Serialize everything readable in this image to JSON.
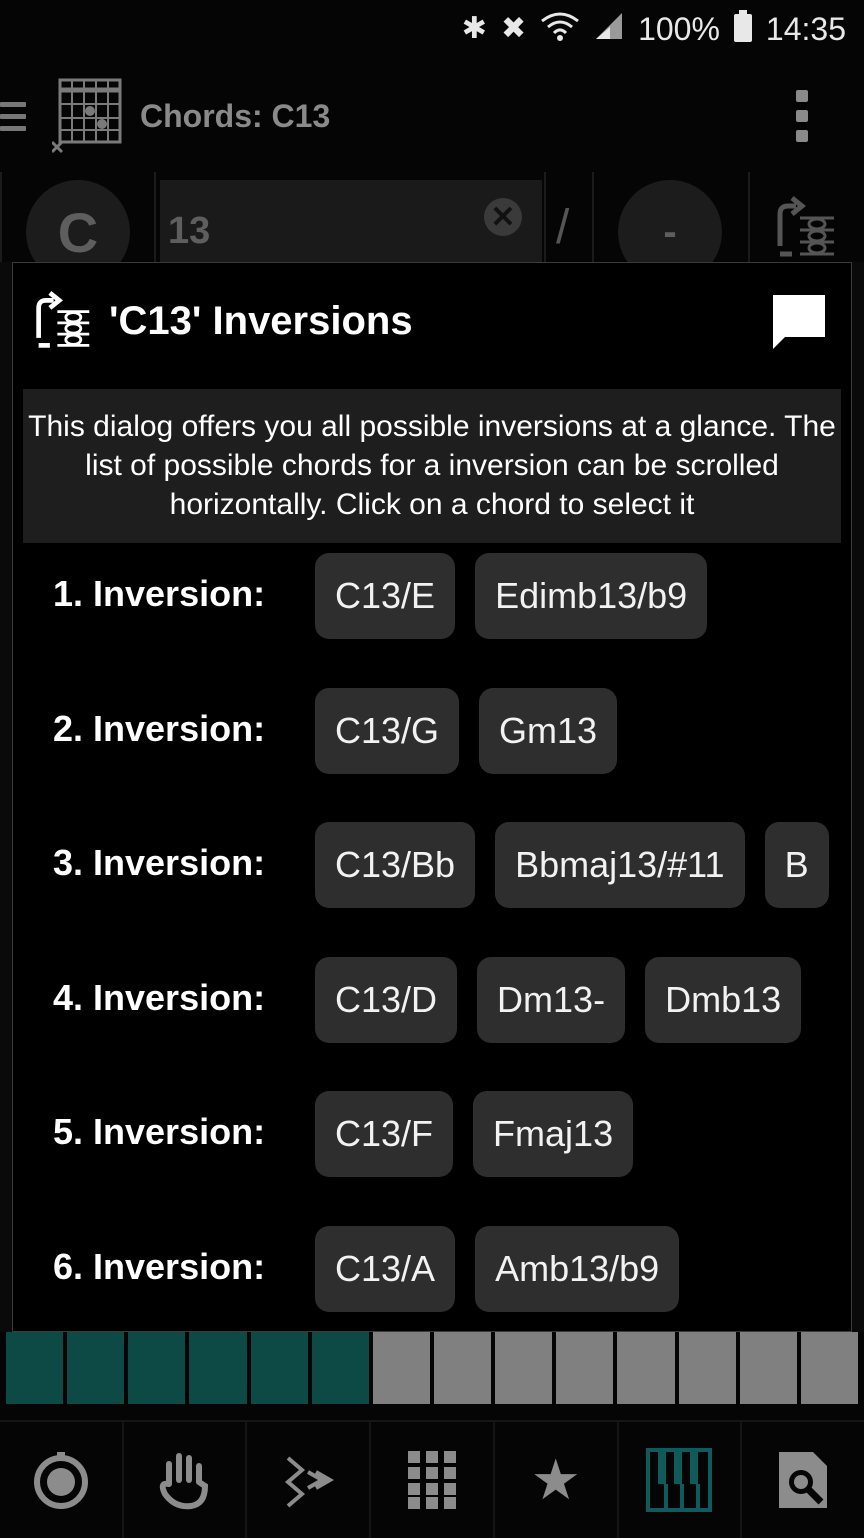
{
  "status_bar": {
    "battery": "100%",
    "time": "14:35",
    "icons": [
      "bluetooth-icon",
      "mute-icon",
      "wifi-icon",
      "signal-icon",
      "battery-icon"
    ]
  },
  "app_bar": {
    "title": "Chords: C13"
  },
  "chord_input": {
    "root": "C",
    "type": "13",
    "slash": "/",
    "bass": "-"
  },
  "dialog": {
    "title": "'C13' Inversions",
    "description": "This dialog offers you all possible inversions at a glance. The list of possible chords for a inversion can be scrolled horizontally. Click on a chord to select it",
    "inversions": [
      {
        "label": "1. Inversion:",
        "chords": [
          "C13/E",
          "Edimb13/b9"
        ]
      },
      {
        "label": "2. Inversion:",
        "chords": [
          "C13/G",
          "Gm13"
        ]
      },
      {
        "label": "3. Inversion:",
        "chords": [
          "C13/Bb",
          "Bbmaj13/#11",
          "B"
        ]
      },
      {
        "label": "4. Inversion:",
        "chords": [
          "C13/D",
          "Dm13-",
          "Dmb13"
        ]
      },
      {
        "label": "5. Inversion:",
        "chords": [
          "C13/F",
          "Fmaj13"
        ]
      },
      {
        "label": "6. Inversion:",
        "chords": [
          "C13/A",
          "Amb13/b9"
        ]
      }
    ]
  },
  "colors": {
    "chip_bg": "#2e2e2e",
    "accent_teal": "#0d4a45",
    "key_grey": "#808080"
  },
  "bottom_nav": [
    "metronome-icon",
    "hand-icon",
    "arpeggio-icon",
    "grid-icon",
    "star-icon",
    "piano-icon",
    "search-icon"
  ]
}
